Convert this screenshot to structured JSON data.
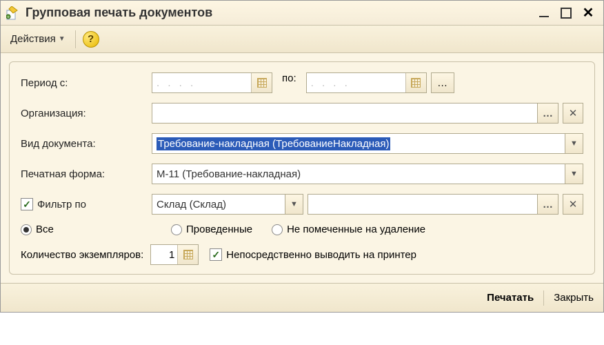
{
  "title": "Групповая печать документов",
  "toolbar": {
    "actions_label": "Действия"
  },
  "form": {
    "period_from_label": "Период с:",
    "period_to_label": "по:",
    "period_from_placeholder": ". .  . .",
    "period_to_placeholder": ". .  . .",
    "organization_label": "Организация:",
    "organization_value": "",
    "doc_type_label": "Вид документа:",
    "doc_type_value": "Требование-накладная (ТребованиеНакладная)",
    "print_form_label": "Печатная форма:",
    "print_form_value": "М-11 (Требование-накладная)",
    "filter_label": "Фильтр по",
    "filter_select_value": "Склад (Склад)",
    "filter_value": "",
    "radio": {
      "all": "Все",
      "posted": "Проведенные",
      "not_marked": "Не помеченные на удаление"
    },
    "copies_label": "Количество экземпляров:",
    "copies_value": "1",
    "direct_print_label": "Непосредственно выводить на принтер"
  },
  "footer": {
    "print": "Печатать",
    "close": "Закрыть"
  }
}
